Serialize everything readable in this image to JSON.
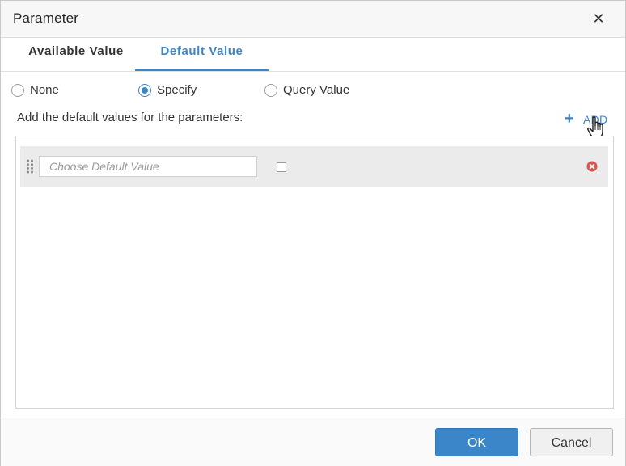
{
  "dialog": {
    "title": "Parameter",
    "close_icon": "close-icon"
  },
  "tabs": [
    {
      "label": "Available Value",
      "active": false
    },
    {
      "label": "Default Value",
      "active": true
    }
  ],
  "options": [
    {
      "label": "None",
      "selected": false
    },
    {
      "label": "Specify",
      "selected": true
    },
    {
      "label": "Query Value",
      "selected": false
    }
  ],
  "instruction": "Add the default values for the parameters:",
  "add": {
    "label": "ADD",
    "icon": "plus-icon"
  },
  "rows": [
    {
      "value": "",
      "placeholder": "Choose Default Value",
      "checked": false
    }
  ],
  "footer": {
    "ok_label": "OK",
    "cancel_label": "Cancel"
  },
  "colors": {
    "accent": "#3a86c8",
    "remove": "#d9534f"
  }
}
